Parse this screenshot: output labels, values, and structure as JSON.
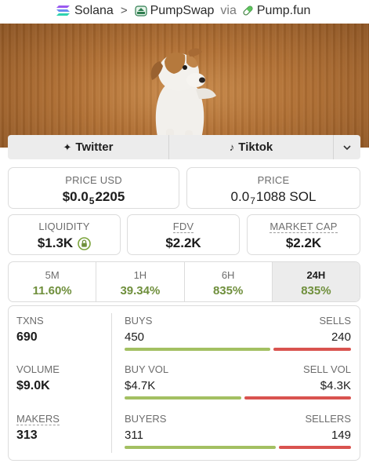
{
  "breadcrumb": {
    "chain": "Solana",
    "dex": "PumpSwap",
    "via": "via",
    "launchpad": "Pump.fun",
    "icons": [
      "solana-icon",
      "pumpswap-icon",
      "pill-icon"
    ]
  },
  "socials": {
    "twitter": "Twitter",
    "tiktok": "Tiktok",
    "more_icon": "chevron-down-icon"
  },
  "price_usd": {
    "label": "PRICE USD",
    "prefix": "$0.0",
    "zeros": "5",
    "digits": "2205"
  },
  "price_native": {
    "label": "PRICE",
    "prefix": "0.0",
    "zeros": "7",
    "digits": "1088 SOL"
  },
  "liquidity": {
    "label": "LIQUIDITY",
    "value": "$1.3K",
    "icon": "lock-icon"
  },
  "fdv": {
    "label": "FDV",
    "value": "$2.2K"
  },
  "market_cap": {
    "label": "MARKET CAP",
    "value": "$2.2K"
  },
  "timeframes": [
    {
      "name": "5M",
      "change": "11.60%"
    },
    {
      "name": "1H",
      "change": "39.34%"
    },
    {
      "name": "6H",
      "change": "835%"
    },
    {
      "name": "24H",
      "change": "835%",
      "active": true
    }
  ],
  "stats": {
    "txns": {
      "label": "TXNS",
      "value": "690"
    },
    "buys": {
      "label": "BUYS",
      "value": "450",
      "fraction": 0.652
    },
    "sells": {
      "label": "SELLS",
      "value": "240",
      "fraction": 0.348
    },
    "volume": {
      "label": "VOLUME",
      "value": "$9.0K"
    },
    "buy_vol": {
      "label": "BUY VOL",
      "value": "$4.7K",
      "fraction": 0.522
    },
    "sell_vol": {
      "label": "SELL VOL",
      "value": "$4.3K",
      "fraction": 0.478
    },
    "makers": {
      "label": "MAKERS",
      "value": "313"
    },
    "buyers": {
      "label": "BUYERS",
      "value": "311",
      "fraction": 0.676
    },
    "sellers": {
      "label": "SELLERS",
      "value": "149",
      "fraction": 0.324
    }
  },
  "colors": {
    "positive": "#6f8f3c",
    "buy_bar": "#a3c062",
    "sell_bar": "#d9534f"
  }
}
